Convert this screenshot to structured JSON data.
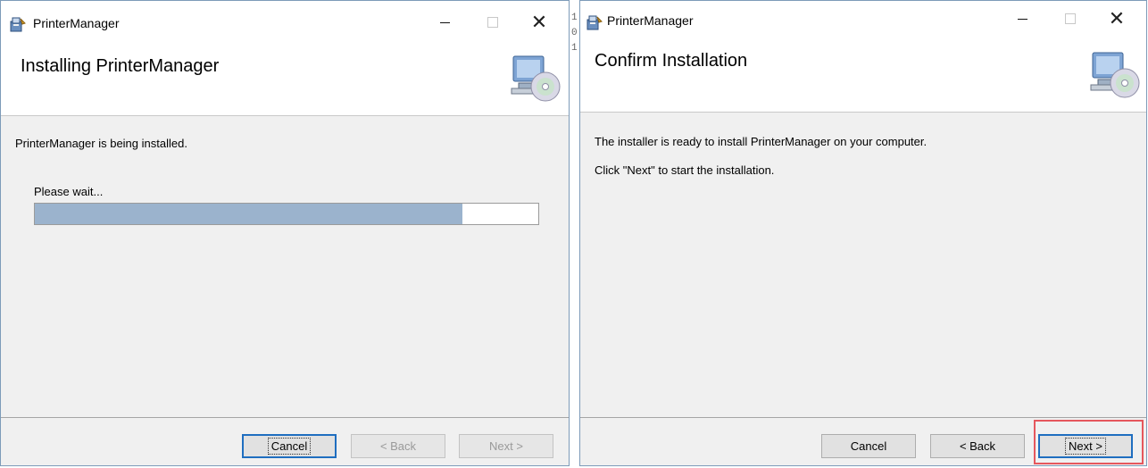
{
  "windows": [
    {
      "title": "PrinterManager",
      "header_title": "Installing PrinterManager",
      "body_lines": [
        "PrinterManager is being installed."
      ],
      "progress": {
        "label": "Please wait...",
        "fraction": 0.85
      },
      "buttons": {
        "cancel": "Cancel",
        "back": "< Back",
        "next": "Next >"
      },
      "button_state": {
        "cancel": "default",
        "back": "disabled",
        "next": "disabled"
      }
    },
    {
      "title": "PrinterManager",
      "header_title": "Confirm Installation",
      "body_lines": [
        "The installer is ready to install PrinterManager on your computer.",
        "Click \"Next\" to start the installation."
      ],
      "buttons": {
        "cancel": "Cancel",
        "back": "< Back",
        "next": "Next >"
      },
      "button_state": {
        "cancel": "enabled",
        "back": "enabled",
        "next": "default"
      }
    }
  ],
  "background_text": [
    "1",
    "0",
    "1"
  ],
  "icons": {
    "app": "installer-package-icon",
    "header": "computer-cd-icon",
    "minimize": "minimize-icon",
    "maximize": "maximize-icon",
    "close": "close-icon"
  },
  "colors": {
    "progress_fill": "#9bb3cd",
    "default_button_border": "#1f6ec0",
    "highlight_box": "#e5575d",
    "window_border": "#7d9bb9"
  }
}
